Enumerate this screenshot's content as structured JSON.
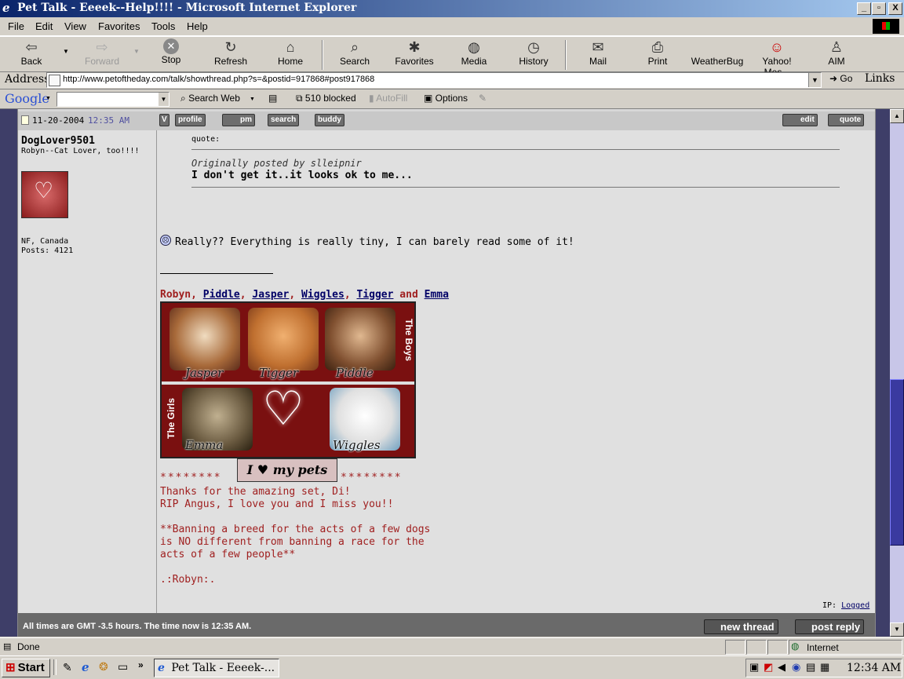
{
  "window": {
    "title": "Pet Talk - Eeeek--Help!!!! - Microsoft Internet Explorer",
    "controls": [
      "_",
      "▫",
      "X"
    ]
  },
  "menu": [
    "File",
    "Edit",
    "View",
    "Favorites",
    "Tools",
    "Help"
  ],
  "toolbar": {
    "buttons": [
      {
        "label": "Back",
        "icon": "back-arrow-icon",
        "glyph": "⇦"
      },
      {
        "label": "Forward",
        "icon": "forward-arrow-icon",
        "glyph": "⇨"
      },
      {
        "label": "Stop",
        "icon": "stop-icon",
        "glyph": "✕"
      },
      {
        "label": "Refresh",
        "icon": "refresh-icon",
        "glyph": "↻"
      },
      {
        "label": "Home",
        "icon": "home-icon",
        "glyph": "⌂"
      },
      {
        "label": "Search",
        "icon": "search-icon",
        "glyph": "⌕"
      },
      {
        "label": "Favorites",
        "icon": "favorites-icon",
        "glyph": "✱"
      },
      {
        "label": "Media",
        "icon": "media-icon",
        "glyph": "◍"
      },
      {
        "label": "History",
        "icon": "history-icon",
        "glyph": "◷"
      },
      {
        "label": "Mail",
        "icon": "mail-icon",
        "glyph": "✉"
      },
      {
        "label": "Print",
        "icon": "print-icon",
        "glyph": "⎙"
      },
      {
        "label": "WeatherBug",
        "icon": "weatherbug-icon",
        "glyph": ""
      },
      {
        "label": "Yahoo! Mes...",
        "icon": "yahoo-messenger-icon",
        "glyph": "☺"
      },
      {
        "label": "AIM",
        "icon": "aim-icon",
        "glyph": "♙"
      }
    ]
  },
  "address": {
    "label": "Address",
    "url": "http://www.petoftheday.com/talk/showthread.php?s=&postid=917868#post917868",
    "go": "Go",
    "links": "Links"
  },
  "google_bar": {
    "logo": "Google",
    "search_web": "Search Web",
    "blocked": "510 blocked",
    "autofill": "AutoFill",
    "options": "Options"
  },
  "post": {
    "date": "11-20-2004",
    "time": "12:35 AM",
    "buttons": [
      "profile",
      "pm",
      "search",
      "buddy"
    ],
    "right_buttons": [
      "edit",
      "quote"
    ],
    "username": "DogLover9501",
    "user_title": "Robyn--Cat Lover, too!!!!",
    "location": "NF, Canada",
    "posts": "Posts: 4121",
    "quote_label": "quote:",
    "quote_author": "Originally posted by slleipnir",
    "quote_text": "I don't get it..it looks ok to me...",
    "message": "Really?? Everything is really tiny, I can barely read some of it!",
    "sig_names": {
      "robyn": "Robyn",
      "comma1": ", ",
      "piddle": "Piddle",
      "comma2": ", ",
      "jasper": "Jasper",
      "comma3": ", ",
      "wiggles": "Wiggles",
      "comma4": ", ",
      "tigger": "Tigger",
      "and": " and ",
      "emma": "Emma"
    },
    "sig_image_labels": {
      "the_boys": "The Boys",
      "the_girls": "The Girls",
      "jasper": "Jasper",
      "tigger": "Tigger",
      "piddle": "Piddle",
      "emma": "Emma",
      "wiggles": "Wiggles",
      "banner": "I ♥ my pets"
    },
    "stars_left": "********",
    "stars_right": "********",
    "sig_lines": [
      "Thanks for the amazing set, Di!",
      "RIP Angus, I love you and I miss you!!",
      "",
      "**Banning a breed for the acts of a few dogs",
      "is NO different from banning a race for the",
      "acts of a few people**",
      "",
      ".:Robyn:."
    ],
    "ip_label": "IP:",
    "ip_value": "Logged"
  },
  "footer": {
    "times": "All times are GMT -3.5 hours. The time now is 12:35 AM.",
    "new_thread": "new thread",
    "post_reply": "post reply"
  },
  "status": {
    "text": "Done",
    "zone": "Internet"
  },
  "taskbar": {
    "start": "Start",
    "task": "Pet Talk - Eeeek-...",
    "clock": "12:34 AM"
  },
  "colors": {
    "sig_red": "#a02020",
    "link_navy": "#000066",
    "forum_bg": "#d8d8d8"
  }
}
